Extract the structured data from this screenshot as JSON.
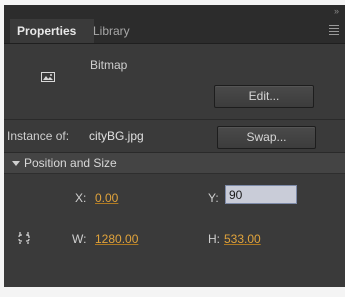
{
  "tabs": [
    {
      "label": "Properties",
      "active": true
    },
    {
      "label": "Library",
      "active": false
    }
  ],
  "symbol": {
    "type_label": "Bitmap",
    "edit_label": "Edit..."
  },
  "instance": {
    "label": "Instance of:",
    "value": "cityBG.jpg",
    "swap_label": "Swap..."
  },
  "position_size": {
    "title": "Position and Size",
    "x_label": "X:",
    "x_value": "0.00",
    "y_label": "Y:",
    "y_value": "90",
    "w_label": "W:",
    "w_value": "1280.00",
    "h_label": "H:",
    "h_value": "533.00"
  },
  "icons": {
    "collapse": "double-chevron-icon",
    "menu": "panel-menu-icon",
    "bitmap": "bitmap-icon",
    "link": "link-icon"
  },
  "colors": {
    "panel_bg": "#3a3a3a",
    "value_orange": "#e0a33c",
    "input_bg": "#c9ccd8"
  }
}
